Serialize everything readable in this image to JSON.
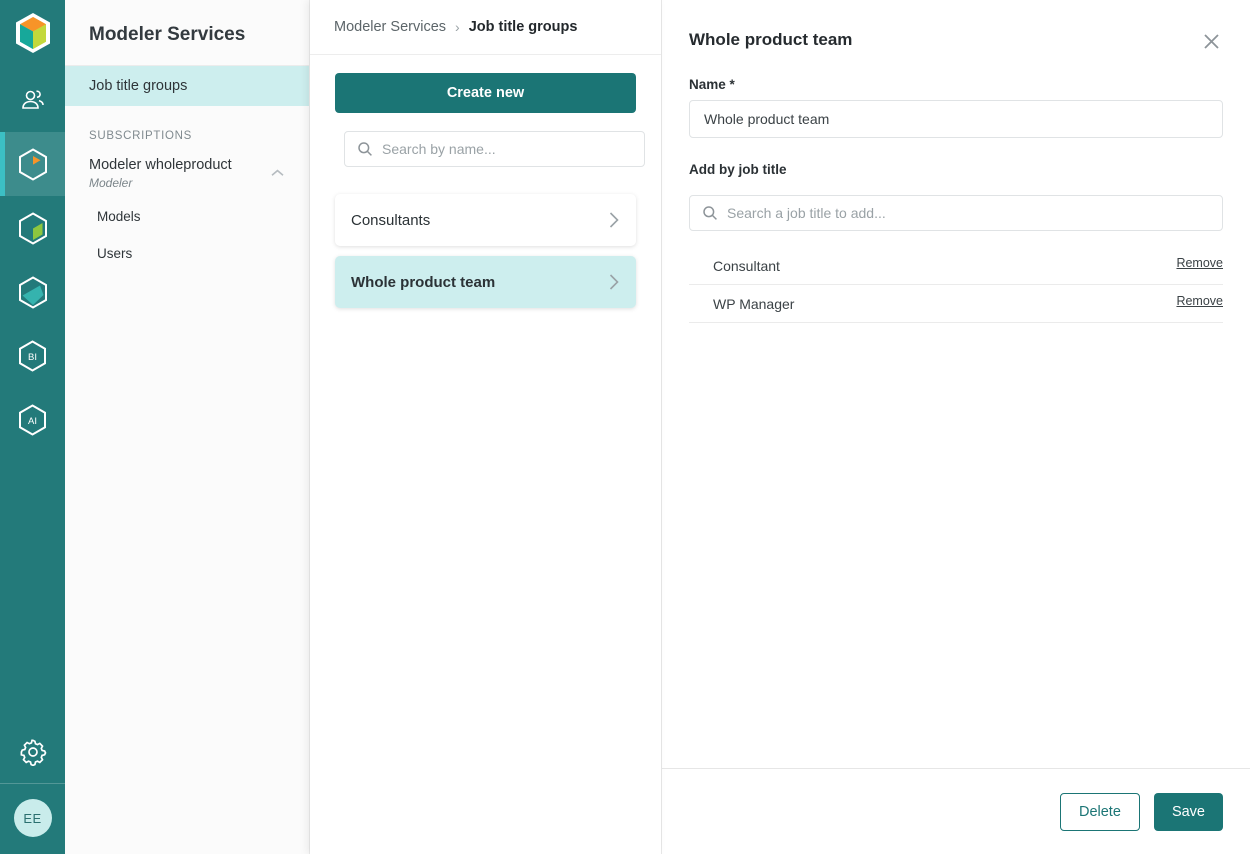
{
  "rail": {
    "logo_icon": "cube-logo-icon",
    "items": [
      {
        "icon": "people-icon",
        "name": "rail-item-people",
        "active": false
      },
      {
        "icon": "hexagon-orange-segment-icon",
        "name": "rail-item-modeler-services",
        "active": true
      },
      {
        "icon": "hexagon-green-segment-icon",
        "name": "rail-item-models",
        "active": false
      },
      {
        "icon": "hexagon-teal-band-icon",
        "name": "rail-item-data",
        "active": false
      },
      {
        "icon": "hexagon-bi-icon",
        "label": "BI",
        "name": "rail-item-bi",
        "active": false
      },
      {
        "icon": "hexagon-ai-icon",
        "label": "AI",
        "name": "rail-item-ai",
        "active": false
      }
    ],
    "settings_icon": "gear-icon",
    "avatar_initials": "EE"
  },
  "sidebar": {
    "title": "Modeler Services",
    "nav": [
      {
        "label": "Job title groups",
        "selected": true
      }
    ],
    "section_label": "SUBSCRIPTIONS",
    "subscription": {
      "name": "Modeler wholeproduct",
      "plan": "Modeler",
      "collapse_icon": "chevron-up-icon",
      "children": [
        {
          "label": "Models"
        },
        {
          "label": "Users"
        }
      ]
    }
  },
  "middle": {
    "breadcrumb": {
      "parent": "Modeler Services",
      "separator": "›",
      "current": "Job title groups"
    },
    "create_button": "Create new",
    "search": {
      "placeholder": "Search by name...",
      "value": "",
      "icon": "search-icon"
    },
    "groups": [
      {
        "label": "Consultants",
        "selected": false,
        "chevron": "chevron-right-icon"
      },
      {
        "label": "Whole product team",
        "selected": true,
        "chevron": "chevron-right-icon"
      }
    ]
  },
  "detail": {
    "title": "Whole product team",
    "close_icon": "close-icon",
    "name_label": "Name *",
    "name_value": "Whole product team",
    "name_placeholder": "Name",
    "add_label": "Add by job title",
    "add_search": {
      "placeholder": "Search a job title to add...",
      "value": "",
      "icon": "search-icon"
    },
    "job_titles": [
      {
        "name": "Consultant",
        "remove_label": "Remove"
      },
      {
        "name": "WP Manager",
        "remove_label": "Remove"
      }
    ],
    "footer": {
      "delete_label": "Delete",
      "save_label": "Save"
    }
  },
  "colors": {
    "brand_teal": "#1b7575",
    "rail_teal": "#237a7a",
    "accent_cyan": "#3cbfc4",
    "highlight": "#cdeeee",
    "logo_orange": "#f79428",
    "logo_lime": "#c3d83c",
    "logo_teal": "#17a89a"
  }
}
